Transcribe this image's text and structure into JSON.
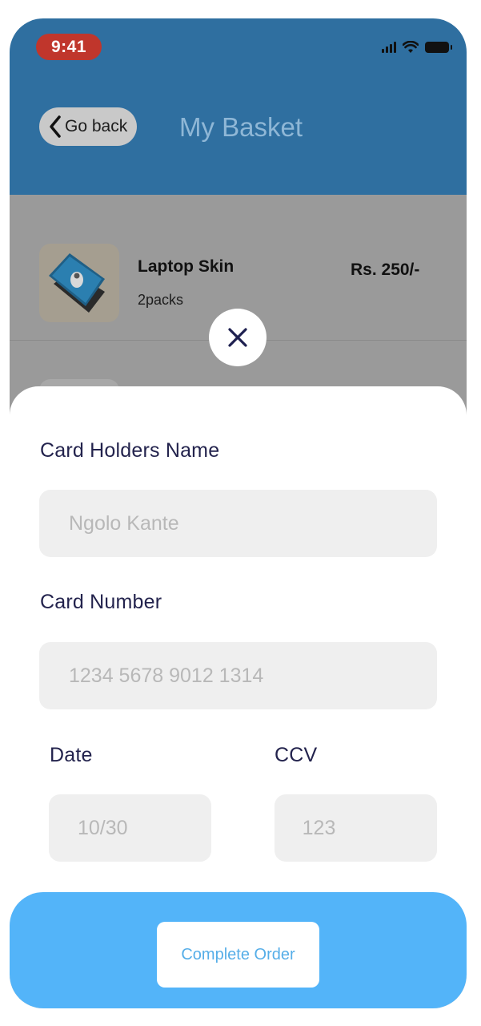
{
  "status_bar": {
    "time": "9:41"
  },
  "header": {
    "back_label": "Go back",
    "title": "My Basket"
  },
  "basket": {
    "items": [
      {
        "name": "Laptop Skin",
        "quantity": "2packs",
        "price": "Rs. 250/-"
      }
    ]
  },
  "payment_form": {
    "card_holder_label": "Card Holders Name",
    "card_holder_placeholder": "Ngolo Kante",
    "card_number_label": "Card Number",
    "card_number_placeholder": "1234 5678 9012 1314",
    "date_label": "Date",
    "date_placeholder": "10/30",
    "ccv_label": "CCV",
    "ccv_placeholder": "123"
  },
  "actions": {
    "complete_order": "Complete Order"
  },
  "icons": {
    "back": "chevron-left-icon",
    "close": "close-icon",
    "signal": "signal-icon",
    "wifi": "wifi-icon",
    "battery": "battery-icon"
  },
  "colors": {
    "header": "#2f6fa0",
    "overlay": "#9a9a9a",
    "accent": "#53b4f9",
    "label_text": "#23234d",
    "button_text": "#56aee8",
    "time_badge": "#c0362c"
  }
}
